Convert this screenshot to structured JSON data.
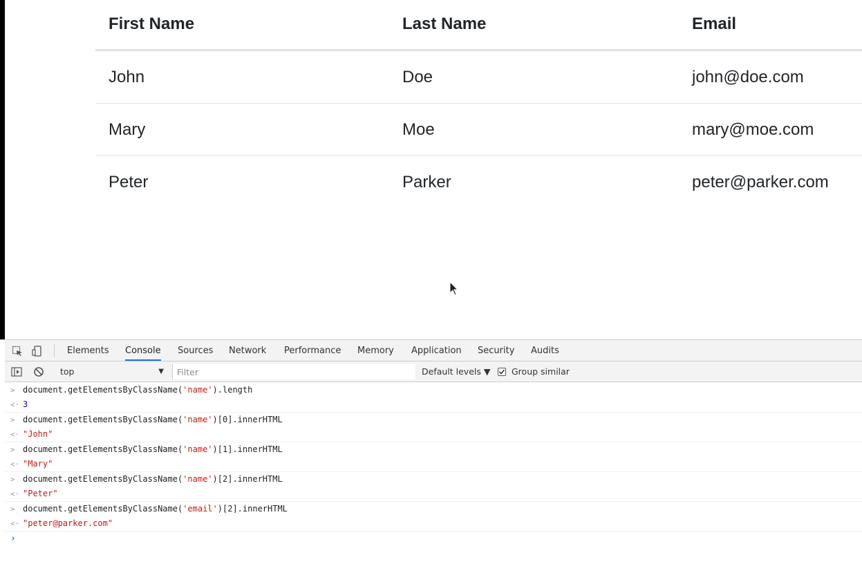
{
  "table": {
    "headers": [
      "First Name",
      "Last Name",
      "Email"
    ],
    "rows": [
      [
        "John",
        "Doe",
        "john@doe.com"
      ],
      [
        "Mary",
        "Moe",
        "mary@moe.com"
      ],
      [
        "Peter",
        "Parker",
        "peter@parker.com"
      ]
    ]
  },
  "devtools": {
    "tabs": [
      "Elements",
      "Console",
      "Sources",
      "Network",
      "Performance",
      "Memory",
      "Application",
      "Security",
      "Audits"
    ],
    "active_tab": "Console",
    "toolbar": {
      "context": "top",
      "filter_placeholder": "Filter",
      "levels": "Default levels ▼",
      "group_similar": "Group similar",
      "group_similar_checked": true
    },
    "console": [
      {
        "pre": "document.getElementsByClassName(",
        "str": "'name'",
        "post": ").length",
        "result": "3",
        "result_type": "number"
      },
      {
        "pre": "document.getElementsByClassName(",
        "str": "'name'",
        "post": ")[0].innerHTML",
        "result": "\"John\"",
        "result_type": "string"
      },
      {
        "pre": "document.getElementsByClassName(",
        "str": "'name'",
        "post": ")[1].innerHTML",
        "result": "\"Mary\"",
        "result_type": "string"
      },
      {
        "pre": "document.getElementsByClassName(",
        "str": "'name'",
        "post": ")[2].innerHTML",
        "result": "\"Peter\"",
        "result_type": "string"
      },
      {
        "pre": "document.getElementsByClassName(",
        "str": "'email'",
        "post": ")[2].innerHTML",
        "result": "\"peter@parker.com\"",
        "result_type": "string"
      }
    ]
  }
}
